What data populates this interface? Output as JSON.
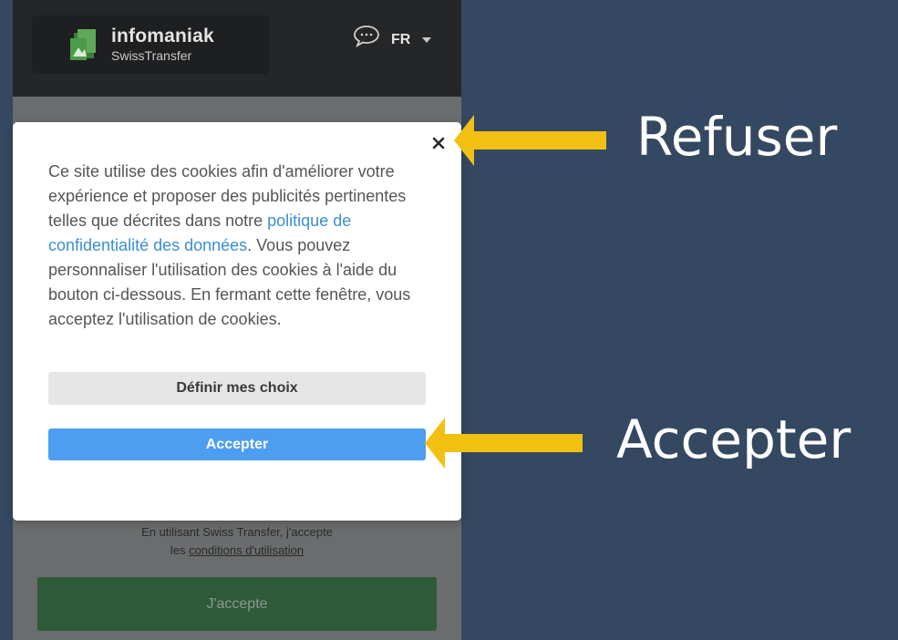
{
  "header": {
    "brand_name": "infomaniak",
    "brand_sub": "SwissTransfer",
    "language": "FR"
  },
  "background_page": {
    "terms_line1": "En utilisant Swiss Transfer, j'accepte",
    "terms_prefix": "les ",
    "terms_link": "conditions d'utilisation",
    "accept_button": "J'accepte"
  },
  "cookie_modal": {
    "text_before_link": "Ce site utilise des cookies afin d'améliorer votre expérience et proposer des publicités pertinentes telles que décrites dans notre ",
    "policy_link": "politique de confidentialité des données",
    "text_after_link": ". Vous pouvez personnaliser l'utilisation des cookies à l'aide du bouton ci-dessous. En fermant cette fenêtre, vous acceptez l'utilisation de cookies.",
    "choices_button": "Définir mes choix",
    "accept_button": "Accepter"
  },
  "annotations": {
    "refuse_label": "Refuser",
    "accept_label": "Accepter",
    "arrow_color": "#f2c012"
  },
  "colors": {
    "background": "#354861",
    "accept_blue": "#4d9ef0",
    "link_blue": "#3a8fd0",
    "page_green": "#2f5a38"
  }
}
